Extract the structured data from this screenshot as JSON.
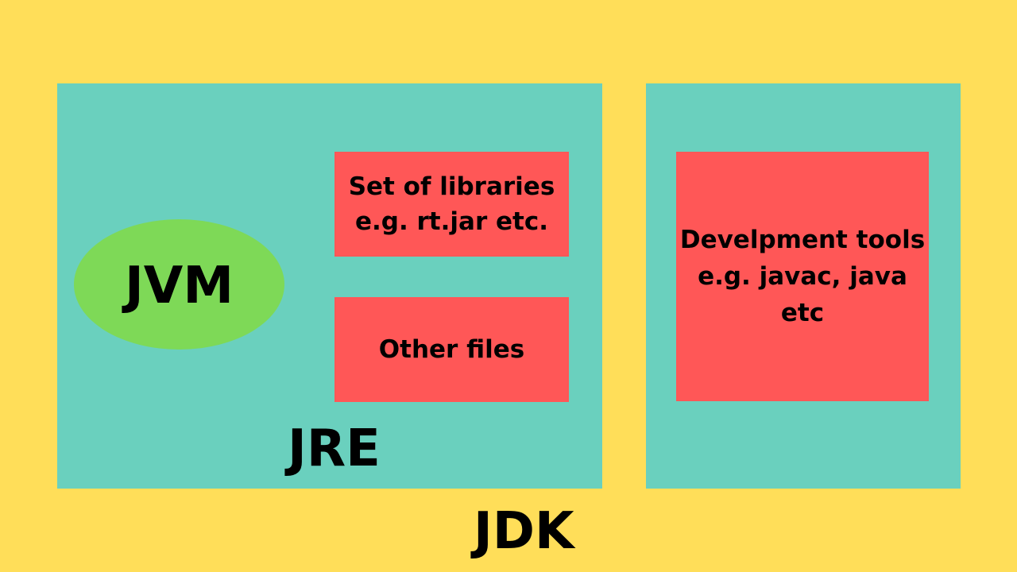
{
  "diagram": {
    "jvm": "JVM",
    "jre": "JRE",
    "jdk": "JDK",
    "libraries": [
      "Set of libraries",
      "e.g. rt.jar etc."
    ],
    "other_files": "Other files",
    "dev_tools": [
      "Develpment tools",
      "e.g. javac, java",
      "etc"
    ]
  },
  "colors": {
    "background": "#FFDE59",
    "container": "#6AD0BE",
    "component": "#FF5757",
    "jvm": "#7ED957",
    "text": "#000000"
  }
}
